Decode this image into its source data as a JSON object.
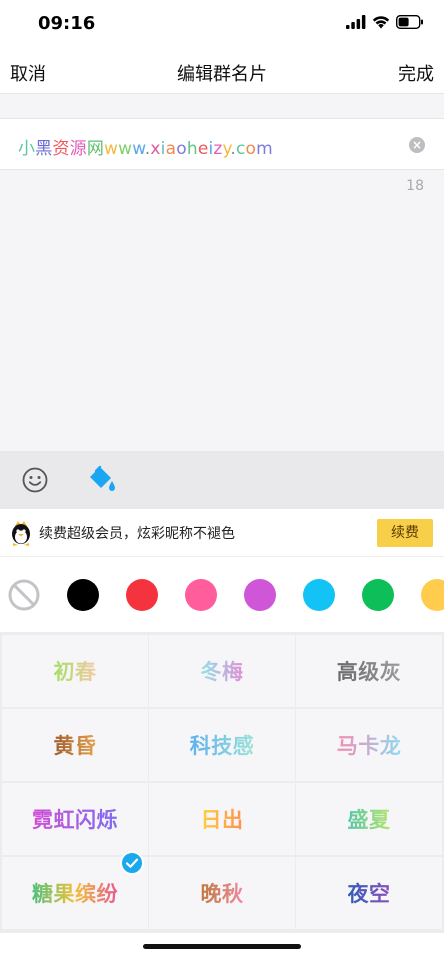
{
  "status": {
    "time": "09:16"
  },
  "nav": {
    "cancel": "取消",
    "title": "编辑群名片",
    "done": "完成"
  },
  "name_input": {
    "segments": [
      {
        "text": "小",
        "color": "#5cc6a0"
      },
      {
        "text": "黑",
        "color": "#6a6ad8"
      },
      {
        "text": "资",
        "color": "#f0575a"
      },
      {
        "text": "源",
        "color": "#e25dbb"
      },
      {
        "text": "网",
        "color": "#5bbf6b"
      },
      {
        "text": "w",
        "color": "#f5b941"
      },
      {
        "text": "w",
        "color": "#7fd06e"
      },
      {
        "text": "w",
        "color": "#5aa7e8"
      },
      {
        "text": ".",
        "color": "#888888"
      },
      {
        "text": "x",
        "color": "#e05a9e"
      },
      {
        "text": "i",
        "color": "#5dbfc0"
      },
      {
        "text": "a",
        "color": "#f08a4b"
      },
      {
        "text": "o",
        "color": "#7c7ce0"
      },
      {
        "text": "h",
        "color": "#5cc684"
      },
      {
        "text": "e",
        "color": "#f0575a"
      },
      {
        "text": "i",
        "color": "#5aa7e8"
      },
      {
        "text": "z",
        "color": "#e25dbb"
      },
      {
        "text": "y",
        "color": "#f5b941"
      },
      {
        "text": ".",
        "color": "#888888"
      },
      {
        "text": "c",
        "color": "#5cc6a0"
      },
      {
        "text": "o",
        "color": "#f08a4b"
      },
      {
        "text": "m",
        "color": "#7c7ce0"
      }
    ],
    "char_count": "18"
  },
  "vip_banner": {
    "text": "续费超级会员，炫彩昵称不褪色",
    "button": "续费"
  },
  "colors": [
    {
      "name": "black",
      "hex": "#000000"
    },
    {
      "name": "red",
      "hex": "#f5333f"
    },
    {
      "name": "pink",
      "hex": "#ff5d9b"
    },
    {
      "name": "purple",
      "hex": "#cf56d6"
    },
    {
      "name": "cyan",
      "hex": "#13c3f5"
    },
    {
      "name": "green",
      "hex": "#0dbf58"
    },
    {
      "name": "yellow",
      "hex": "#ffcc4d"
    }
  ],
  "styles": [
    {
      "label": "初春",
      "gradient": [
        "#a6df64",
        "#f5c9a6"
      ]
    },
    {
      "label": "冬梅",
      "gradient": [
        "#8ee3e8",
        "#e38cd6"
      ]
    },
    {
      "label": "高级灰",
      "gradient": [
        "#6b6b6b",
        "#9b9b9b"
      ]
    },
    {
      "label": "黄昏",
      "gradient": [
        "#a15e2c",
        "#e8a24c"
      ]
    },
    {
      "label": "科技感",
      "gradient": [
        "#5fb0ef",
        "#9be3d8"
      ]
    },
    {
      "label": "马卡龙",
      "gradient": [
        "#f48ab4",
        "#8fd9ee"
      ]
    },
    {
      "label": "霓虹闪烁",
      "gradient": [
        "#d24fd6",
        "#7f6df0"
      ]
    },
    {
      "label": "日出",
      "gradient": [
        "#ffcf3f",
        "#ff8f4f"
      ]
    },
    {
      "label": "盛夏",
      "gradient": [
        "#58c7a6",
        "#b6e36c"
      ]
    },
    {
      "label": "糖果缤纷",
      "gradient": [
        "#4cc07a",
        "#f3c13a",
        "#e6588f"
      ]
    },
    {
      "label": "晚秋",
      "gradient": [
        "#c27a3e",
        "#f08aa0"
      ]
    },
    {
      "label": "夜空",
      "gradient": [
        "#2f5db8",
        "#8c4fbf"
      ]
    }
  ],
  "selected_style": "糖果缤纷"
}
